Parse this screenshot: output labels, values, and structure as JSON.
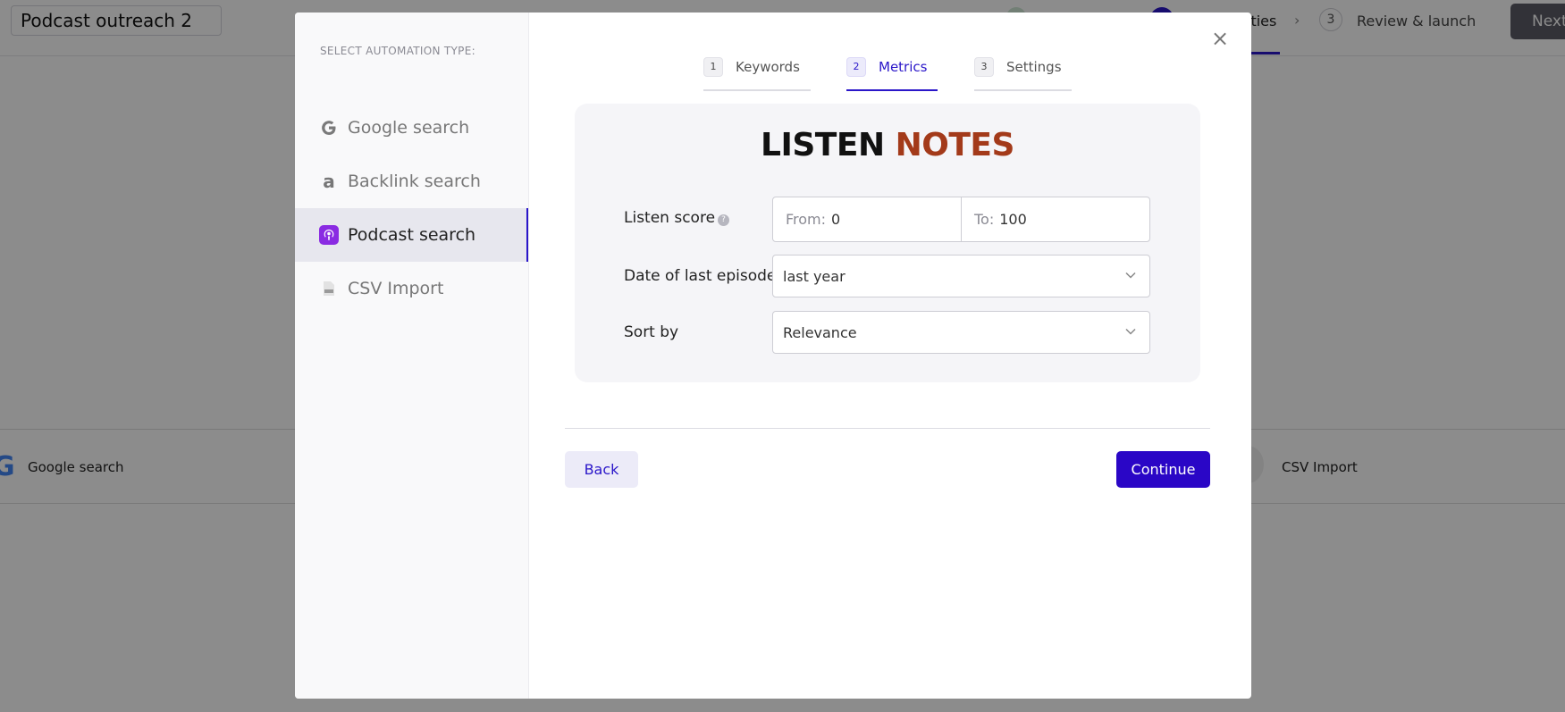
{
  "header": {
    "campaign_name": "Podcast outreach 2",
    "step_2_label": "ities",
    "step_3_number": "3",
    "step_3_label": "Review & launch",
    "next_label": "Next"
  },
  "bottom_bar": {
    "google_label": "Google search",
    "csv_label": "CSV Import"
  },
  "modal": {
    "sidebar": {
      "title": "SELECT AUTOMATION TYPE:",
      "items": [
        {
          "label": "Google search",
          "icon": "google-icon"
        },
        {
          "label": "Backlink search",
          "icon": "ahrefs-icon"
        },
        {
          "label": "Podcast search",
          "icon": "podcast-icon",
          "active": true
        },
        {
          "label": "CSV Import",
          "icon": "csv-file-icon"
        }
      ]
    },
    "tabs": [
      {
        "number": "1",
        "label": "Keywords"
      },
      {
        "number": "2",
        "label": "Metrics",
        "active": true
      },
      {
        "number": "3",
        "label": "Settings"
      }
    ],
    "logo": {
      "word1": "LISTEN",
      "word2": "NOTES"
    },
    "listen_score": {
      "label": "Listen score",
      "from_prefix": "From:",
      "from_value": "0",
      "to_prefix": "To:",
      "to_value": "100"
    },
    "last_episode": {
      "label": "Date of last episode",
      "value": "last year"
    },
    "sort_by": {
      "label": "Sort by",
      "value": "Relevance"
    },
    "back_label": "Back",
    "continue_label": "Continue"
  },
  "colors": {
    "accent": "#2a06c6",
    "logo_notes": "#a33a1a",
    "podcast_icon": "#8a2be2"
  }
}
